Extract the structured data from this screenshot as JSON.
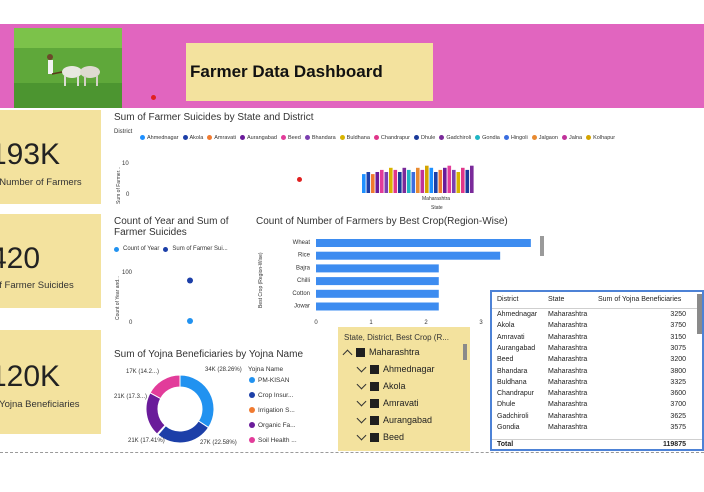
{
  "header": {
    "title": "Farmer Data Dashboard"
  },
  "kpis": [
    {
      "value": "193K",
      "label": "f Number of Farmers"
    },
    {
      "value": "420",
      "label": "of Farmer Suicides"
    },
    {
      "value": "120K",
      "label": "f Yojna Beneficiaries"
    }
  ],
  "colors": {
    "banner": "#e165bf",
    "card": "#f3e29e",
    "bar": "#3d8cf0",
    "table_border": "#4d82d6"
  },
  "chart_data": [
    {
      "type": "bar",
      "title": "Sum of Farmer Suicides by State and District",
      "legend_title": "District",
      "legend": [
        "Ahmednagar",
        "Akola",
        "Amravati",
        "Aurangabad",
        "Beed",
        "Bhandara",
        "Buldhana",
        "Chandrapur",
        "Dhule",
        "Gadchiroli",
        "Gondia",
        "Hingoli",
        "Jalgaon",
        "Jalna",
        "Kolhapur"
      ],
      "legend_colors": [
        "#1e90ff",
        "#1c3fa8",
        "#f07a30",
        "#6a1b9a",
        "#e23c9a",
        "#7b3fb0",
        "#d8b400",
        "#e0368a",
        "#1a3a9a",
        "#7a2a9a",
        "#1fb5c4",
        "#3a6ee0",
        "#e88a30",
        "#c0329a",
        "#d4a400"
      ],
      "xlabel": "State",
      "ylabel": "Sum of Farmer...",
      "x_tick": "Maharashtra",
      "y_ticks": [
        "0",
        "10"
      ],
      "ylim": [
        0,
        20
      ],
      "values": [
        9,
        10,
        9,
        10,
        11,
        10,
        12,
        11,
        10,
        12,
        11,
        10,
        12,
        11,
        13,
        12,
        10,
        11,
        12,
        13,
        11,
        10,
        12,
        11,
        13
      ]
    },
    {
      "type": "scatter",
      "title": "Count of Year and Sum of Farmer Suicides",
      "legend": [
        "Count of Year",
        "Sum of Farmer Sui..."
      ],
      "ylabel": "Count of Year and...",
      "y_ticks": [
        "0",
        "100"
      ],
      "ylim": [
        0,
        150
      ],
      "series": [
        {
          "name": "Count of Year",
          "values": [
            0
          ]
        },
        {
          "name": "Sum of Farmer Sui...",
          "values": [
            80
          ]
        }
      ]
    },
    {
      "type": "bar",
      "orientation": "horizontal",
      "title": "Count of Number of Farmers by Best Crop(Region-Wise)",
      "ylabel": "Best Crop (Region-Wise)",
      "categories": [
        "Wheat",
        "Rice",
        "Bajra",
        "Chilli",
        "Cotton",
        "Jowar"
      ],
      "values": [
        3.5,
        3,
        2,
        2,
        2,
        2
      ],
      "x_ticks": [
        "0",
        "1",
        "2",
        "3"
      ],
      "xlim": [
        0,
        3.6
      ]
    },
    {
      "type": "pie",
      "title": "Sum of Yojna Beneficiaries by Yojna Name",
      "legend_title": "Yojna Name",
      "legend": [
        "PM-KISAN",
        "Crop Insur...",
        "Irrigation S...",
        "Organic Fa...",
        "Soil Health ..."
      ],
      "colors": [
        "#2192f0",
        "#1c3fa8",
        "#f07a30",
        "#6a1b9a",
        "#e23c9a"
      ],
      "values": [
        34,
        27,
        0.5,
        21,
        17
      ],
      "labels": [
        "34K (28.26%)",
        "27K (22.58%)",
        "",
        "21K (17.41%)",
        "17K (14.2...)"
      ],
      "extra_label": "21K (17.3...)"
    }
  ],
  "slicer": {
    "title": "State, District, Best Crop (R...",
    "items": [
      "Maharashtra",
      "Ahmednagar",
      "Akola",
      "Amravati",
      "Aurangabad",
      "Beed"
    ]
  },
  "table": {
    "headers": [
      "District",
      "State",
      "Sum of Yojna Beneficiaries"
    ],
    "rows": [
      [
        "Ahmednagar",
        "Maharashtra",
        "3250"
      ],
      [
        "Akola",
        "Maharashtra",
        "3750"
      ],
      [
        "Amravati",
        "Maharashtra",
        "3150"
      ],
      [
        "Aurangabad",
        "Maharashtra",
        "3075"
      ],
      [
        "Beed",
        "Maharashtra",
        "3200"
      ],
      [
        "Bhandara",
        "Maharashtra",
        "3800"
      ],
      [
        "Buldhana",
        "Maharashtra",
        "3325"
      ],
      [
        "Chandrapur",
        "Maharashtra",
        "3600"
      ],
      [
        "Dhule",
        "Maharashtra",
        "3700"
      ],
      [
        "Gadchiroli",
        "Maharashtra",
        "3625"
      ],
      [
        "Gondia",
        "Maharashtra",
        "3575"
      ]
    ],
    "total_label": "Total",
    "total_value": "119875"
  }
}
